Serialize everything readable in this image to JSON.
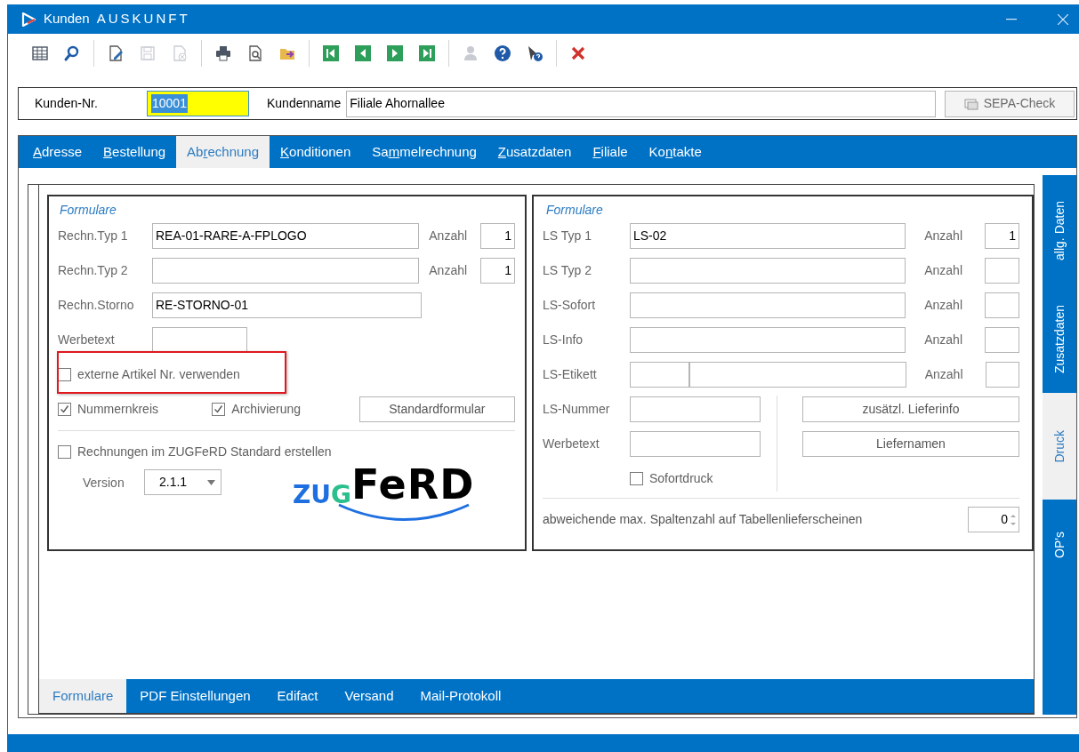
{
  "window": {
    "title": "Kunden",
    "subtitle": "AUSKUNFT"
  },
  "toolbar": [
    [
      {
        "kind": "table",
        "disabled": false
      },
      {
        "kind": "search",
        "disabled": false
      }
    ],
    [
      {
        "kind": "edit",
        "disabled": false
      },
      {
        "kind": "save",
        "disabled": true
      },
      {
        "kind": "delete",
        "disabled": true
      }
    ],
    [
      {
        "kind": "print",
        "disabled": false
      },
      {
        "kind": "preview",
        "disabled": false
      },
      {
        "kind": "export",
        "disabled": false
      }
    ],
    [
      {
        "kind": "first",
        "disabled": false
      },
      {
        "kind": "prev",
        "disabled": false
      },
      {
        "kind": "next",
        "disabled": false
      },
      {
        "kind": "last",
        "disabled": false
      }
    ],
    [
      {
        "kind": "user",
        "disabled": true
      },
      {
        "kind": "help",
        "disabled": false
      },
      {
        "kind": "pointer-help",
        "disabled": false
      }
    ],
    [
      {
        "kind": "close",
        "disabled": false
      }
    ]
  ],
  "customer": {
    "number_label": "Kunden-Nr.",
    "number": "10001",
    "name_label": "Kundenname",
    "name": "Filiale Ahornallee",
    "sepa_button": "SEPA-Check"
  },
  "tabs": [
    {
      "key": "A",
      "after": "dresse",
      "selected": false
    },
    {
      "key": "B",
      "after": "estellung",
      "selected": false
    },
    {
      "before": "Ab",
      "key": "r",
      "after": "echnung",
      "selected": true
    },
    {
      "key": "K",
      "after": "onditionen",
      "selected": false
    },
    {
      "before": "Sa",
      "key": "m",
      "after": "melrechnung",
      "selected": false
    },
    {
      "key": "Z",
      "after": "usatzdaten",
      "selected": false
    },
    {
      "key": "F",
      "after": "iliale",
      "selected": false
    },
    {
      "before": "Ko",
      "key": "n",
      "after": "takte",
      "selected": false
    }
  ],
  "left_group": {
    "title": "Formulare",
    "rows": [
      {
        "kind": "wide",
        "label": "Rechn.Typ 1",
        "value": "REA-01-RARE-A-FPLOGO",
        "count_label": "Anzahl",
        "count": "1"
      },
      {
        "kind": "wide",
        "label": "Rechn.Typ 2",
        "count_label": "Anzahl",
        "count": "1"
      },
      {
        "kind": "wide",
        "label": "Rechn.Storno",
        "value": "RE-STORNO-01"
      },
      {
        "kind": "short",
        "label": "Werbetext"
      }
    ],
    "external_checkbox": {
      "label": "externe Artikel Nr. verwenden",
      "checked": false,
      "highlighted": true
    },
    "options": [
      {
        "label": "Nummernkreis",
        "checked": true
      },
      {
        "label": "Archivierung",
        "checked": true
      }
    ],
    "standard_button": "Standardformular",
    "zugferd_checkbox": {
      "label": "Rechnungen im ZUGFeRD Standard erstellen",
      "checked": false
    },
    "version_label": "Version",
    "version": "2.1.1",
    "logo": {
      "first": "ZU",
      "second": "G",
      "third": "FeRD"
    }
  },
  "right_group": {
    "title": "Formulare",
    "rows": [
      {
        "kind": "wide",
        "label": "LS Typ 1",
        "value": "LS-02",
        "count_label": "Anzahl",
        "count": "1"
      },
      {
        "kind": "wide",
        "label": "LS Typ 2",
        "count_label": "Anzahl"
      },
      {
        "kind": "wide",
        "label": "LS-Sofort",
        "count_label": "Anzahl"
      },
      {
        "kind": "wide",
        "label": "LS-Info",
        "count_label": "Anzahl"
      },
      {
        "kind": "split",
        "label": "LS-Etikett",
        "count_label": "Anzahl"
      }
    ],
    "short_rows": [
      {
        "label": "LS-Nummer"
      },
      {
        "label": "Werbetext"
      }
    ],
    "buttons": [
      "zusätzl. Lieferinfo",
      "Liefernamen"
    ],
    "sofortdruck": {
      "label": "Sofortdruck",
      "checked": false
    },
    "columns_label": "abweichende max. Spaltenzahl auf Tabellenlieferscheinen",
    "columns_value": "0"
  },
  "side_tabs": [
    {
      "label": "allg. Daten",
      "selected": false
    },
    {
      "label": "Zusatzdaten",
      "selected": false
    },
    {
      "label": "Druck",
      "selected": true
    },
    {
      "label": "OP's",
      "selected": false
    }
  ],
  "bottom_tabs": [
    {
      "label": "Formulare",
      "selected": true
    },
    {
      "label": "PDF Einstellungen",
      "selected": false
    },
    {
      "label": "Edifact",
      "selected": false
    },
    {
      "label": "Versand",
      "selected": false
    },
    {
      "label": "Mail-Protokoll",
      "selected": false
    }
  ]
}
